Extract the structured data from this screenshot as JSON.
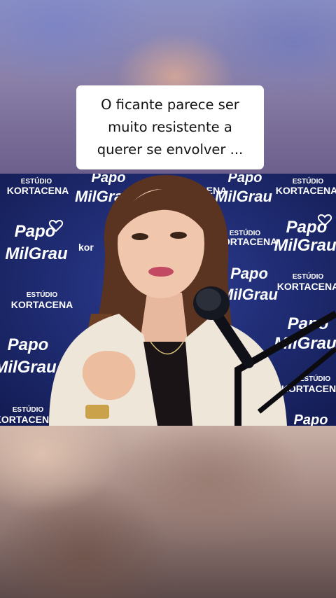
{
  "caption": {
    "line1": "O ficante parece ser",
    "line2": "muito resistente a",
    "line3": "querer se envolver ..."
  },
  "backdrop": {
    "studio_small": "ESTÚDIO",
    "studio_big": "KORTACENA",
    "papo": "Papo",
    "milgrau": "MilGrau"
  },
  "colors": {
    "backdrop_blue": "#1d2a6e",
    "caption_bg": "#ffffff",
    "caption_text": "#111111"
  }
}
